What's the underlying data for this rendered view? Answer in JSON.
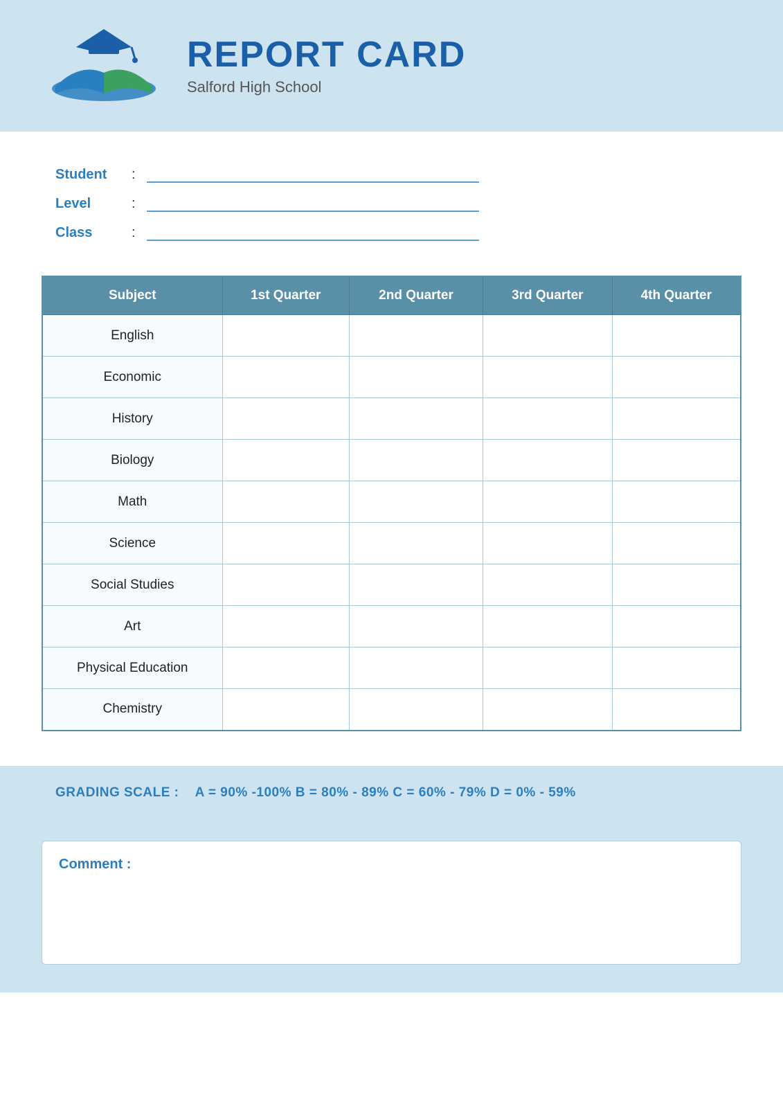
{
  "header": {
    "title": "REPORT CARD",
    "school": "Salford High School"
  },
  "student_info": {
    "student_label": "Student",
    "level_label": "Level",
    "class_label": "Class",
    "colon": ":"
  },
  "table": {
    "headers": [
      "Subject",
      "1st Quarter",
      "2nd Quarter",
      "3rd Quarter",
      "4th Quarter"
    ],
    "rows": [
      {
        "subject": "English"
      },
      {
        "subject": "Economic"
      },
      {
        "subject": "History"
      },
      {
        "subject": "Biology"
      },
      {
        "subject": "Math"
      },
      {
        "subject": "Science"
      },
      {
        "subject": "Social Studies"
      },
      {
        "subject": "Art"
      },
      {
        "subject": "Physical Education"
      },
      {
        "subject": "Chemistry"
      }
    ]
  },
  "grading_scale": {
    "label": "GRADING SCALE :",
    "text": "A = 90% -100%  B = 80% - 89%  C = 60% - 79%  D = 0% - 59%"
  },
  "comment": {
    "label": "Comment :"
  }
}
